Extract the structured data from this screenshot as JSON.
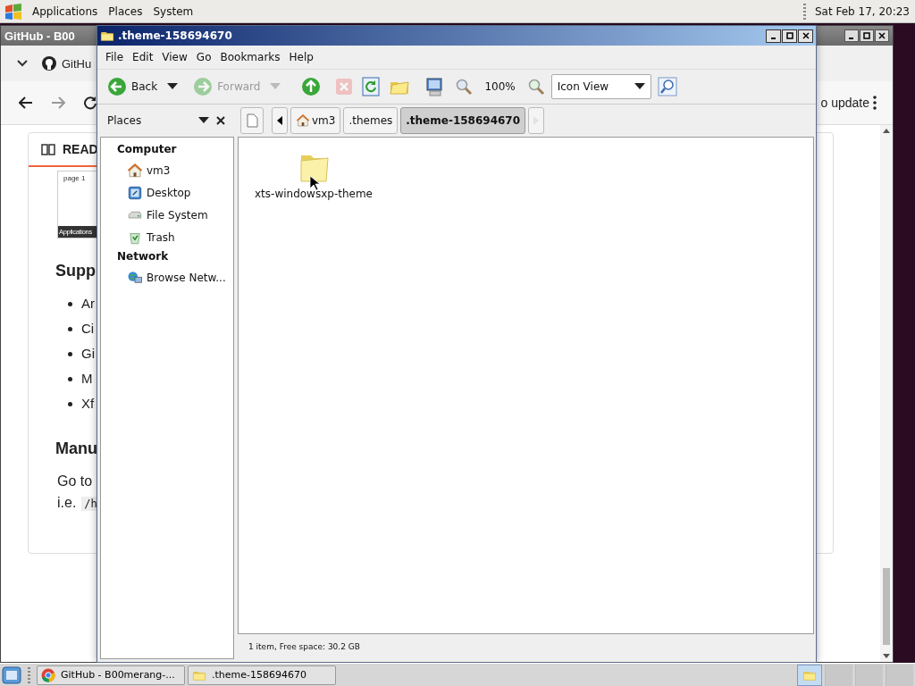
{
  "top_panel": {
    "menus": [
      "Applications",
      "Places",
      "System"
    ],
    "clock": "Sat Feb 17, 20:23"
  },
  "browser_window": {
    "title": "GitHub - B00",
    "tab": "GitHu",
    "toolbar_text": "o update",
    "readme_tab": "READ",
    "thumbnail": {
      "tab_label": "page 1",
      "bar_label": "Applications"
    },
    "heading_1": "Supp",
    "bullets": [
      "Ar",
      "Ci",
      "Gi",
      "M",
      "Xf"
    ],
    "heading_2": "Manu",
    "paragraph": "Go to",
    "line_2": "i.e.",
    "code": "/h"
  },
  "file_manager": {
    "title": ".theme-158694670",
    "menu": [
      "File",
      "Edit",
      "View",
      "Go",
      "Bookmarks",
      "Help"
    ],
    "toolbar": [
      {
        "kind": "back",
        "label": "Back",
        "disabled": false
      },
      {
        "kind": "forward",
        "label": "Forward",
        "disabled": true
      },
      {
        "kind": "up",
        "disabled": false
      },
      {
        "kind": "stop",
        "disabled": true
      },
      {
        "kind": "reload",
        "disabled": false
      },
      {
        "kind": "home",
        "disabled": false
      },
      {
        "kind": "computer",
        "disabled": false
      },
      {
        "kind": "zoom-out",
        "disabled": false
      },
      {
        "kind": "zoom-level",
        "label": "100%",
        "disabled": false
      },
      {
        "kind": "zoom-in",
        "disabled": false
      },
      {
        "kind": "view-select",
        "label": "Icon View",
        "disabled": false
      },
      {
        "kind": "search",
        "disabled": false
      }
    ],
    "side_pane_title": "Places",
    "path": [
      {
        "label": "vm3",
        "kind": "home",
        "selected": false
      },
      {
        "label": ".themes",
        "kind": "folder",
        "selected": false
      },
      {
        "label": ".theme-158694670",
        "kind": "folder",
        "selected": true
      }
    ],
    "sidebar": [
      {
        "heading": "Computer",
        "items": [
          {
            "label": "vm3",
            "kind": "home"
          },
          {
            "label": "Desktop",
            "kind": "desktop"
          },
          {
            "label": "File System",
            "kind": "drive"
          },
          {
            "label": "Trash",
            "kind": "trash"
          }
        ]
      },
      {
        "heading": "Network",
        "items": [
          {
            "label": "Browse Netw...",
            "kind": "network"
          }
        ]
      }
    ],
    "files": [
      {
        "name": "xts-windowsxp-theme",
        "kind": "folder"
      }
    ],
    "status": "1 item, Free space: 30.2 GB"
  },
  "taskbar": [
    {
      "label": "GitHub - B00merang-...",
      "kind": "browser"
    },
    {
      "label": ".theme-158694670",
      "kind": "folder"
    }
  ]
}
